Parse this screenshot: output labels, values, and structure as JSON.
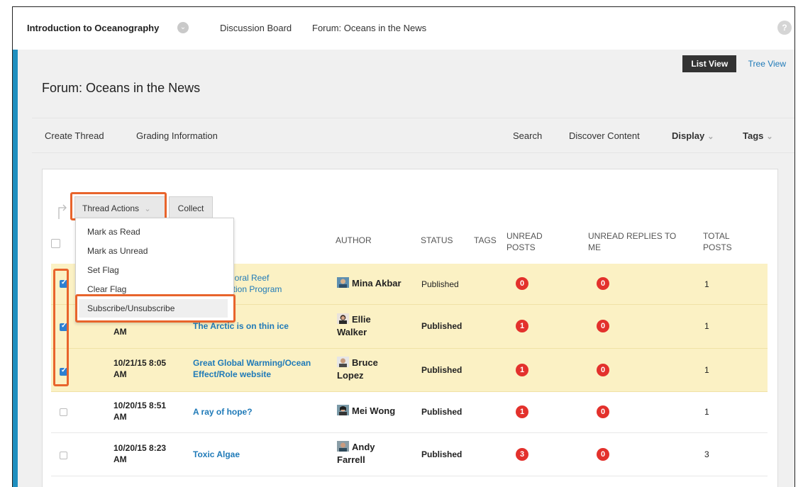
{
  "breadcrumb": {
    "course": "Introduction to Oceanography",
    "discussion_board": "Discussion Board",
    "forum": "Forum: Oceans in the News",
    "help_icon": "?"
  },
  "view_toggle": {
    "list": "List View",
    "tree": "Tree View"
  },
  "page_title": "Forum: Oceans in the News",
  "action_bar": {
    "create_thread": "Create Thread",
    "grading_information": "Grading Information",
    "search": "Search",
    "discover_content": "Discover Content",
    "display": "Display",
    "tags": "Tags",
    "chevron": "⌄"
  },
  "toolbar": {
    "thread_actions": "Thread Actions",
    "collect": "Collect"
  },
  "thread_actions_menu": [
    "Mark as Read",
    "Mark as Unread",
    "Set Flag",
    "Clear Flag",
    "Subscribe/Unsubscribe"
  ],
  "table": {
    "headers": {
      "author": "AUTHOR",
      "status": "STATUS",
      "tags": "TAGS",
      "unread_posts_1": "UNREAD",
      "unread_posts_2": "POSTS",
      "unread_replies_1": "UNREAD REPLIES TO",
      "unread_replies_2": "ME",
      "total_posts_1": "TOTAL",
      "total_posts_2": "POSTS"
    },
    "rows": [
      {
        "checked": true,
        "date_line1": "",
        "date_line2": "",
        "thread_line1": "Coral Reef",
        "thread_line2": "ation Program",
        "author_line1": "Mina Akbar",
        "author_line2": "",
        "status": "Published",
        "unread_posts": "0",
        "unread_replies": "0",
        "total_posts": "1"
      },
      {
        "checked": true,
        "date_line1": "",
        "date_line2": "AM",
        "thread_line1": "The Arctic is on thin ice",
        "thread_line2": "",
        "author_line1": "Ellie",
        "author_line2": "Walker",
        "status": "Published",
        "unread_posts": "1",
        "unread_replies": "0",
        "total_posts": "1"
      },
      {
        "checked": true,
        "date_line1": "10/21/15 8:05",
        "date_line2": "AM",
        "thread_line1": "Great Global Warming/Ocean",
        "thread_line2": "Effect/Role website",
        "author_line1": "Bruce",
        "author_line2": "Lopez",
        "status": "Published",
        "unread_posts": "1",
        "unread_replies": "0",
        "total_posts": "1"
      },
      {
        "checked": false,
        "date_line1": "10/20/15 8:51",
        "date_line2": "AM",
        "thread_line1": "A ray of hope?",
        "thread_line2": "",
        "author_line1": "Mei Wong",
        "author_line2": "",
        "status": "Published",
        "unread_posts": "1",
        "unread_replies": "0",
        "total_posts": "1"
      },
      {
        "checked": false,
        "date_line1": "10/20/15 8:23",
        "date_line2": "AM",
        "thread_line1": "Toxic Algae",
        "thread_line2": "",
        "author_line1": "Andy",
        "author_line2": "Farrell",
        "status": "Published",
        "unread_posts": "3",
        "unread_replies": "0",
        "total_posts": "3"
      }
    ]
  },
  "colors": {
    "accent_blue": "#1f7ab8",
    "left_stripe": "#1f8fbf",
    "highlight_orange": "#e8642c",
    "badge_red": "#e3312c",
    "selected_row": "#fbf1c4"
  }
}
